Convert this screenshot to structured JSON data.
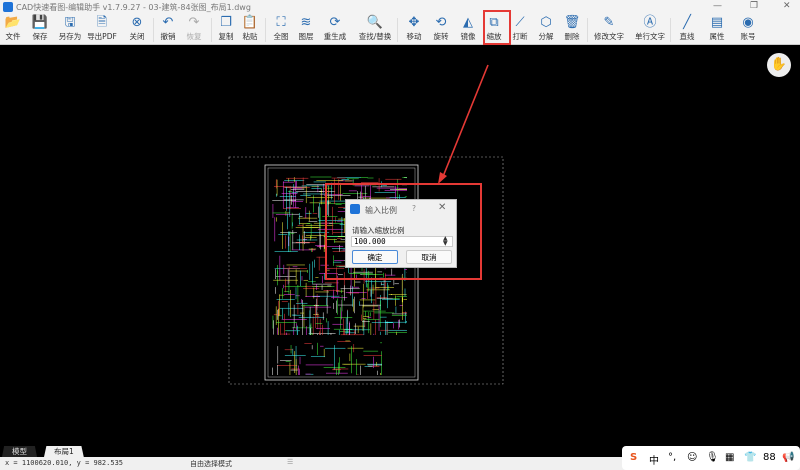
{
  "window": {
    "title": "CAD快速看图-编辑助手 v1.7.9.27 - 03-建筑-84张图_布局1.dwg",
    "minimize": "—",
    "restore": "❐",
    "close": "✕"
  },
  "toolbar": [
    {
      "label": "文件",
      "icon": "folder-icon",
      "g": "📂"
    },
    {
      "label": "保存",
      "icon": "save-icon",
      "g": "💾"
    },
    {
      "label": "另存为",
      "icon": "save-as-icon",
      "g": "🖫"
    },
    {
      "label": "导出PDF",
      "icon": "pdf-icon",
      "g": "🗎"
    },
    {
      "label": "关闭",
      "icon": "close-circle-icon",
      "g": "⊗"
    },
    {
      "label": "撤销",
      "icon": "undo-icon",
      "g": "↶"
    },
    {
      "label": "恢复",
      "icon": "redo-icon",
      "g": "↷"
    },
    {
      "label": "复制",
      "icon": "copy-icon",
      "g": "❐"
    },
    {
      "label": "粘贴",
      "icon": "paste-icon",
      "g": "📋"
    },
    {
      "label": "全图",
      "icon": "fit-view-icon",
      "g": "⛶"
    },
    {
      "label": "图层",
      "icon": "layers-icon",
      "g": "≋"
    },
    {
      "label": "重生成",
      "icon": "regenerate-icon",
      "g": "⟳"
    },
    {
      "label": "查找/替换",
      "icon": "find-replace-icon",
      "g": "🔍"
    },
    {
      "label": "移动",
      "icon": "move-icon",
      "g": "✥"
    },
    {
      "label": "旋转",
      "icon": "rotate-icon",
      "g": "⟲"
    },
    {
      "label": "镜像",
      "icon": "mirror-icon",
      "g": "◭"
    },
    {
      "label": "缩放",
      "icon": "scale-icon",
      "g": "⧉"
    },
    {
      "label": "打断",
      "icon": "break-icon",
      "g": "⟋"
    },
    {
      "label": "分解",
      "icon": "explode-icon",
      "g": "⬡"
    },
    {
      "label": "删除",
      "icon": "delete-icon",
      "g": "🗑"
    },
    {
      "label": "修改文字",
      "icon": "edit-text-icon",
      "g": "✎"
    },
    {
      "label": "单行文字",
      "icon": "single-text-icon",
      "g": "Ⓐ"
    },
    {
      "label": "直线",
      "icon": "line-icon",
      "g": "╱"
    },
    {
      "label": "属性",
      "icon": "properties-icon",
      "g": "▤"
    },
    {
      "label": "账号",
      "icon": "account-icon",
      "g": "◉"
    }
  ],
  "dialog": {
    "title": "输入比例",
    "help": "?",
    "close": "✕",
    "prompt": "请输入缩放比例",
    "value": "100.000",
    "ok": "确定",
    "cancel": "取消"
  },
  "tabs": [
    "模型",
    "布局1"
  ],
  "status": {
    "coords": "x = 1100620.010, y = 982.535",
    "mode": "自由选择模式"
  },
  "ime": [
    "S",
    "中",
    "°,",
    "☺",
    "🎙",
    "▦",
    "👕",
    "88",
    "📢"
  ],
  "colors": {
    "highlight": "#e53935",
    "accent": "#2b6cb0"
  }
}
